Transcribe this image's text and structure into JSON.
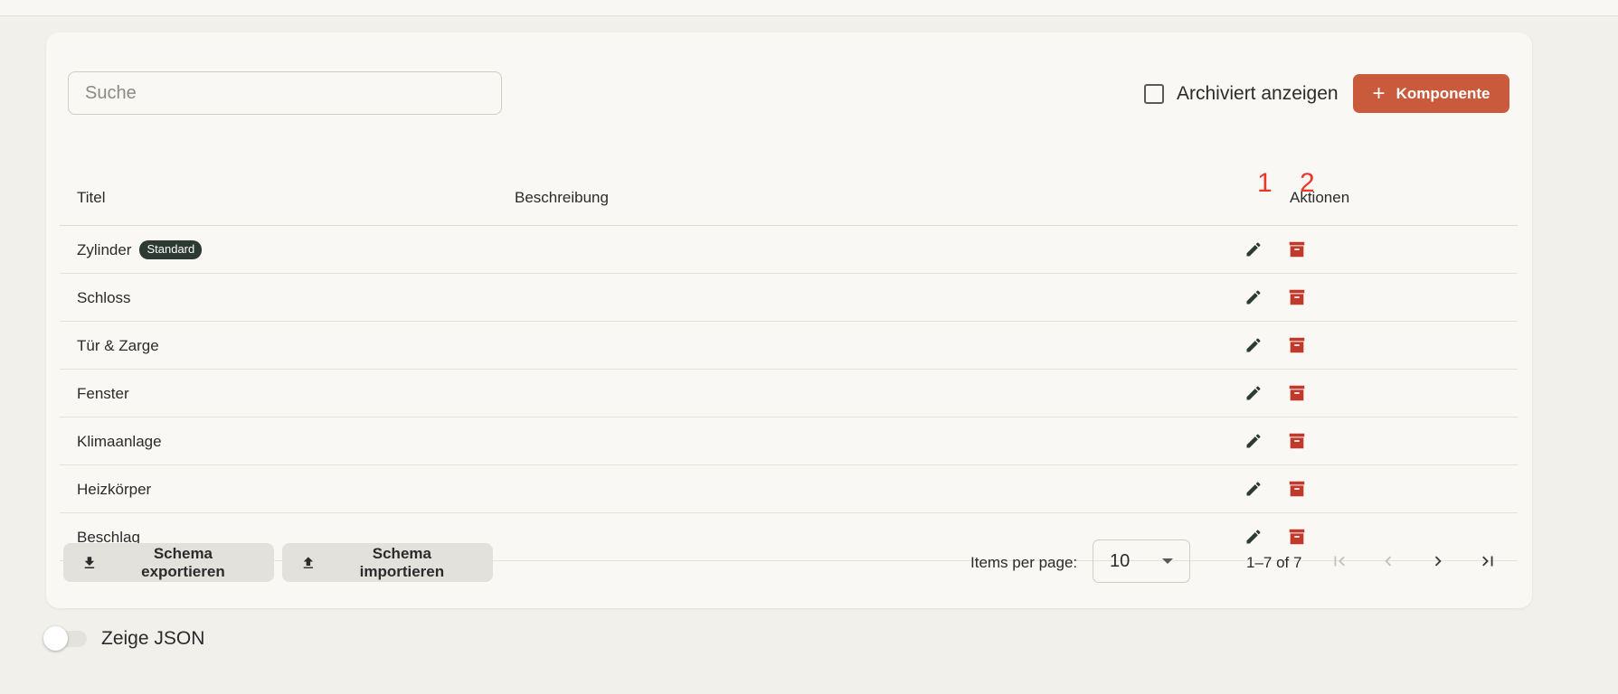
{
  "search": {
    "placeholder": "Suche"
  },
  "toolbar": {
    "archived_label": "Archiviert anzeigen",
    "add_label": "Komponente"
  },
  "table": {
    "headers": {
      "title": "Titel",
      "description": "Beschreibung",
      "actions": "Aktionen"
    },
    "rows": [
      {
        "title": "Zylinder",
        "badge": "Standard",
        "description": ""
      },
      {
        "title": "Schloss",
        "description": ""
      },
      {
        "title": "Tür & Zarge",
        "description": ""
      },
      {
        "title": "Fenster",
        "description": ""
      },
      {
        "title": "Klimaanlage",
        "description": ""
      },
      {
        "title": "Heizkörper",
        "description": ""
      },
      {
        "title": "Beschlag",
        "description": ""
      }
    ]
  },
  "annotations": {
    "edit_marker": "1",
    "archive_marker": "2"
  },
  "footer": {
    "export_label": "Schema exportieren",
    "import_label": "Schema importieren",
    "items_per_page_label": "Items per page:",
    "items_per_page_value": "10",
    "range_label": "1–7 of 7"
  },
  "json_toggle": {
    "label": "Zeige JSON"
  },
  "icons": {
    "edit": "pencil-icon",
    "archive": "archive-icon",
    "download": "download-icon",
    "upload": "upload-icon"
  },
  "colors": {
    "accent": "#c95a3c",
    "archive_icon": "#c0392b",
    "edit_icon": "#2d3a33",
    "badge": "#2d3a33",
    "marker": "#e8382a"
  }
}
